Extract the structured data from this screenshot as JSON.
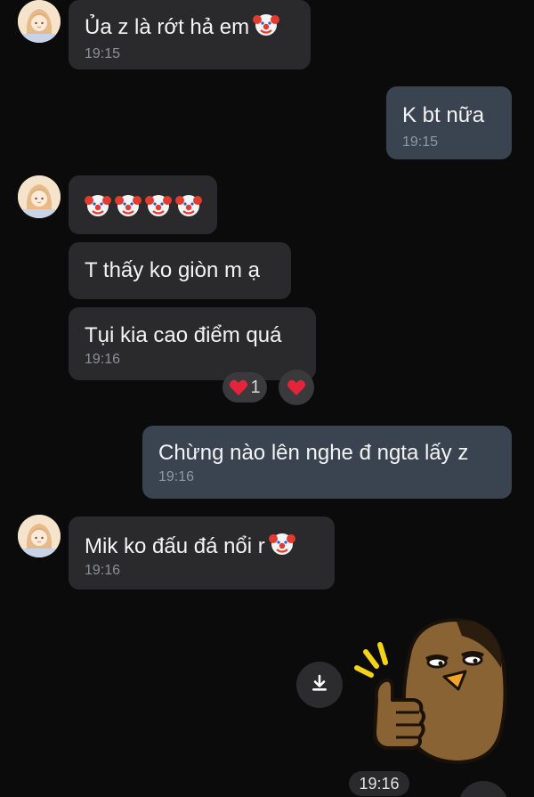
{
  "colors": {
    "background": "#0b0b0c",
    "incoming_bubble": "#2a2a2d",
    "outgoing_bubble": "#3a4350",
    "timestamp": "#8d9197"
  },
  "messages": [
    {
      "side": "in",
      "text": "Ủa z là rớt hả em",
      "emoji": "clown-face",
      "time": "19:15"
    },
    {
      "side": "out",
      "text": "K bt nữa",
      "time": "19:15"
    },
    {
      "side": "in",
      "emojis": [
        "clown-face",
        "clown-face",
        "clown-face",
        "clown-face"
      ]
    },
    {
      "side": "in",
      "text": "T thấy ko giòn m ạ"
    },
    {
      "side": "in",
      "text": "Tụi kia cao điểm quá",
      "time": "19:16",
      "reactions": [
        {
          "icon": "red-heart",
          "count": "1"
        },
        {
          "icon": "red-heart"
        }
      ]
    },
    {
      "side": "out",
      "text": "Chừng nào lên nghe đ ngta lấy z",
      "time": "19:16"
    },
    {
      "side": "in",
      "text": "Mik ko đấu đá nổi r",
      "emoji": "clown-face",
      "time": "19:16"
    },
    {
      "side": "out",
      "type": "sticker",
      "sticker": "bird-thumbs-up",
      "time": "19:16",
      "action_icon": "download-icon"
    }
  ]
}
